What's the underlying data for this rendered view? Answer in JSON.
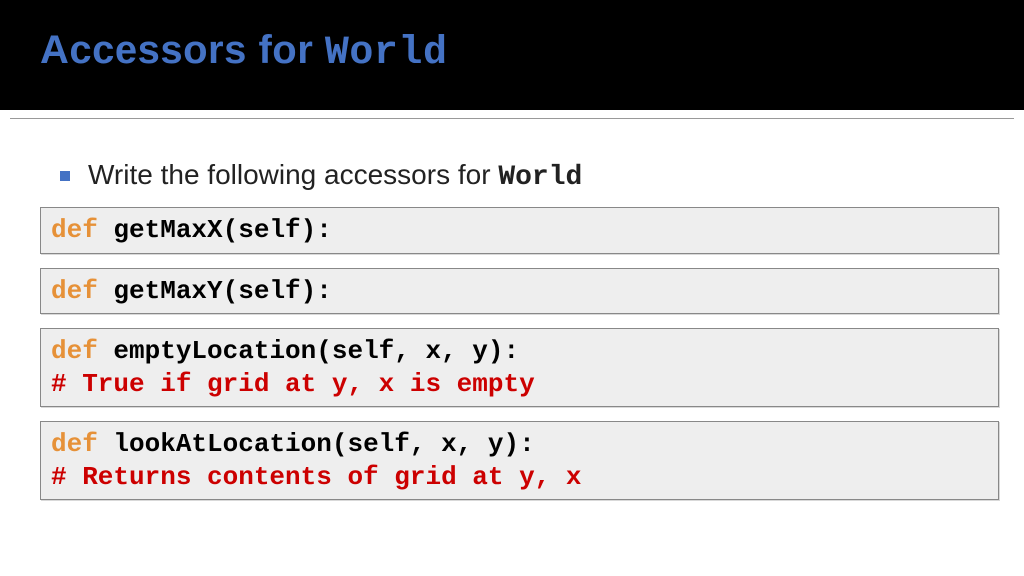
{
  "header": {
    "title_prefix": "Accessors for ",
    "title_code": "World"
  },
  "bullet": {
    "text_prefix": "Write the following accessors for ",
    "text_code": "World"
  },
  "boxes": [
    {
      "kw": "def ",
      "sig": "getMaxX(self):",
      "cmt": ""
    },
    {
      "kw": "def ",
      "sig": "getMaxY(self):",
      "cmt": ""
    },
    {
      "kw": "def ",
      "sig": "emptyLocation(self, x, y):",
      "cmt": "# True if grid at y, x is empty"
    },
    {
      "kw": "def ",
      "sig": "lookAtLocation(self, x, y):",
      "cmt": "# Returns contents of grid at y, x"
    }
  ]
}
